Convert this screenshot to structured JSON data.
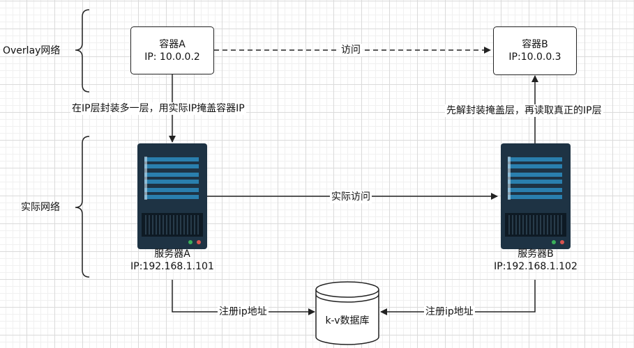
{
  "layers": {
    "overlay": "Overlay网络",
    "physical": "实际网络"
  },
  "container_a": {
    "name": "容器A",
    "ip": "IP: 10.0.0.2"
  },
  "container_b": {
    "name": "容器B",
    "ip": "IP:10.0.0.3"
  },
  "server_a": {
    "name": "服务器A",
    "ip": "IP:192.168.1.101"
  },
  "server_b": {
    "name": "服务器B",
    "ip": "IP:192.168.1.102"
  },
  "database": {
    "label": "k-v数据库"
  },
  "edges": {
    "container_access": "访问",
    "encapsulate": "在IP层封装多一层，用实际IP掩盖容器IP",
    "decapsulate": "先解封装掩盖层，再读取真正的IP层",
    "physical_access": "实际访问",
    "register_a": "注册ip地址",
    "register_b": "注册ip地址"
  },
  "colors": {
    "server_body": "#1e3344",
    "server_panel": "#2a7fae",
    "server_led_green": "#3aaf5a",
    "server_led_red": "#d9534f"
  },
  "icons": [
    "server-icon",
    "database-cylinder-icon"
  ]
}
